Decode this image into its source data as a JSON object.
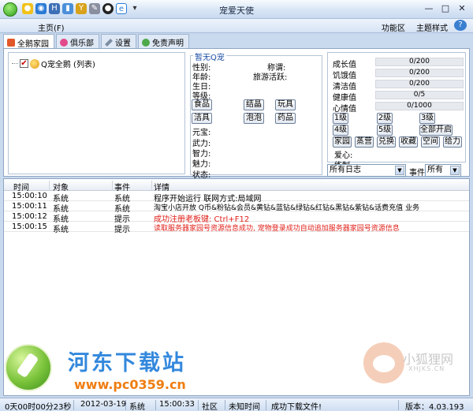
{
  "window": {
    "title": "宠爱天使"
  },
  "quick_access": [
    "bulb-icon",
    "globe-icon",
    "h-icon",
    "chart-icon",
    "y-icon",
    "tool-icon",
    "qq-icon",
    "ie-icon"
  ],
  "menu": {
    "main": "主页(F)",
    "function_area": "功能区",
    "theme": "主题样式",
    "help": "?"
  },
  "window_buttons": {
    "minimize": "—",
    "maximize": "□",
    "close": "✕"
  },
  "tabs": [
    {
      "label": "全鹅家园",
      "icon": "home-icon",
      "active": true
    },
    {
      "label": "俱乐部",
      "icon": "club-icon",
      "active": false
    },
    {
      "label": "设置",
      "icon": "wrench-icon",
      "active": false
    },
    {
      "label": "免责声明",
      "icon": "disclaimer-icon",
      "active": false
    }
  ],
  "tree": {
    "item": "Q宠全鹅 (列表)",
    "checked": "✔"
  },
  "pet_info": {
    "group_title": "暂无Q宠",
    "gender": "性别:",
    "title": "称谓:",
    "age": "年龄:",
    "tour_active": "旅游活跃:",
    "birthday": "生日:",
    "level": "等级:",
    "buttons_row1": [
      "食品",
      "结晶",
      "玩具"
    ],
    "buttons_row2": [
      "洁具",
      "泡泡",
      "药品"
    ],
    "yuanbao": "元宝:",
    "force": "武力:",
    "intel": "智力:",
    "charm": "魅力:",
    "state": "状态:"
  },
  "stats": {
    "rows": [
      {
        "label": "成长值",
        "value": "0/200"
      },
      {
        "label": "饥饿值",
        "value": "0/200"
      },
      {
        "label": "清洁值",
        "value": "0/200"
      },
      {
        "label": "健康值",
        "value": "0/5"
      },
      {
        "label": "心情值",
        "value": "0/1000"
      }
    ],
    "level_buttons": [
      [
        "1级",
        "2级",
        "3级"
      ],
      [
        "4级",
        "5级",
        "全部开启"
      ]
    ],
    "action_buttons": [
      "家园",
      "蒸营",
      "兑换",
      "收藏",
      "空间",
      "给力"
    ],
    "love": "爱心:",
    "training": "练制:"
  },
  "filters": {
    "log_select": "所有日志",
    "event_label": "事件",
    "event_select": "所有"
  },
  "log": {
    "columns": [
      "时间",
      "对象",
      "事件",
      "详情"
    ],
    "rows": [
      {
        "time": "15:00:10",
        "object": "系统",
        "event": "系统",
        "detail": "程序开始运行 联网方式:局域网",
        "highlight": false
      },
      {
        "time": "15:00:11",
        "object": "系统",
        "event": "系统",
        "detail": "淘宝小店开放 Q币&粉钻&会员&黄钻&蓝钻&绿钻&红钻&黑钻&紫钻&话费充值 业务",
        "highlight": false
      },
      {
        "time": "15:00:12",
        "object": "系统",
        "event": "提示",
        "detail": "成功注册老板键: Ctrl+F12",
        "highlight": true
      },
      {
        "time": "15:00:15",
        "object": "系统",
        "event": "提示",
        "detail": "读取服务器家园号资源信息成功, 宠物登录成功自动追加服务器家园号资源信息",
        "highlight": true
      }
    ]
  },
  "watermark": {
    "site_name": "河东下载站",
    "site_url": "www.pc0359.cn",
    "fox_name": "小狐狸网",
    "fox_url": "XHJKS.CN"
  },
  "statusbar": {
    "uptime": "0天00时00分23秒",
    "date": "2012-03-19",
    "system": "系统",
    "clock": "15:00:33",
    "community": "社区",
    "unknown_time": "未知时间",
    "download": "成功下载文件!",
    "version": "版本：4.03.193"
  }
}
